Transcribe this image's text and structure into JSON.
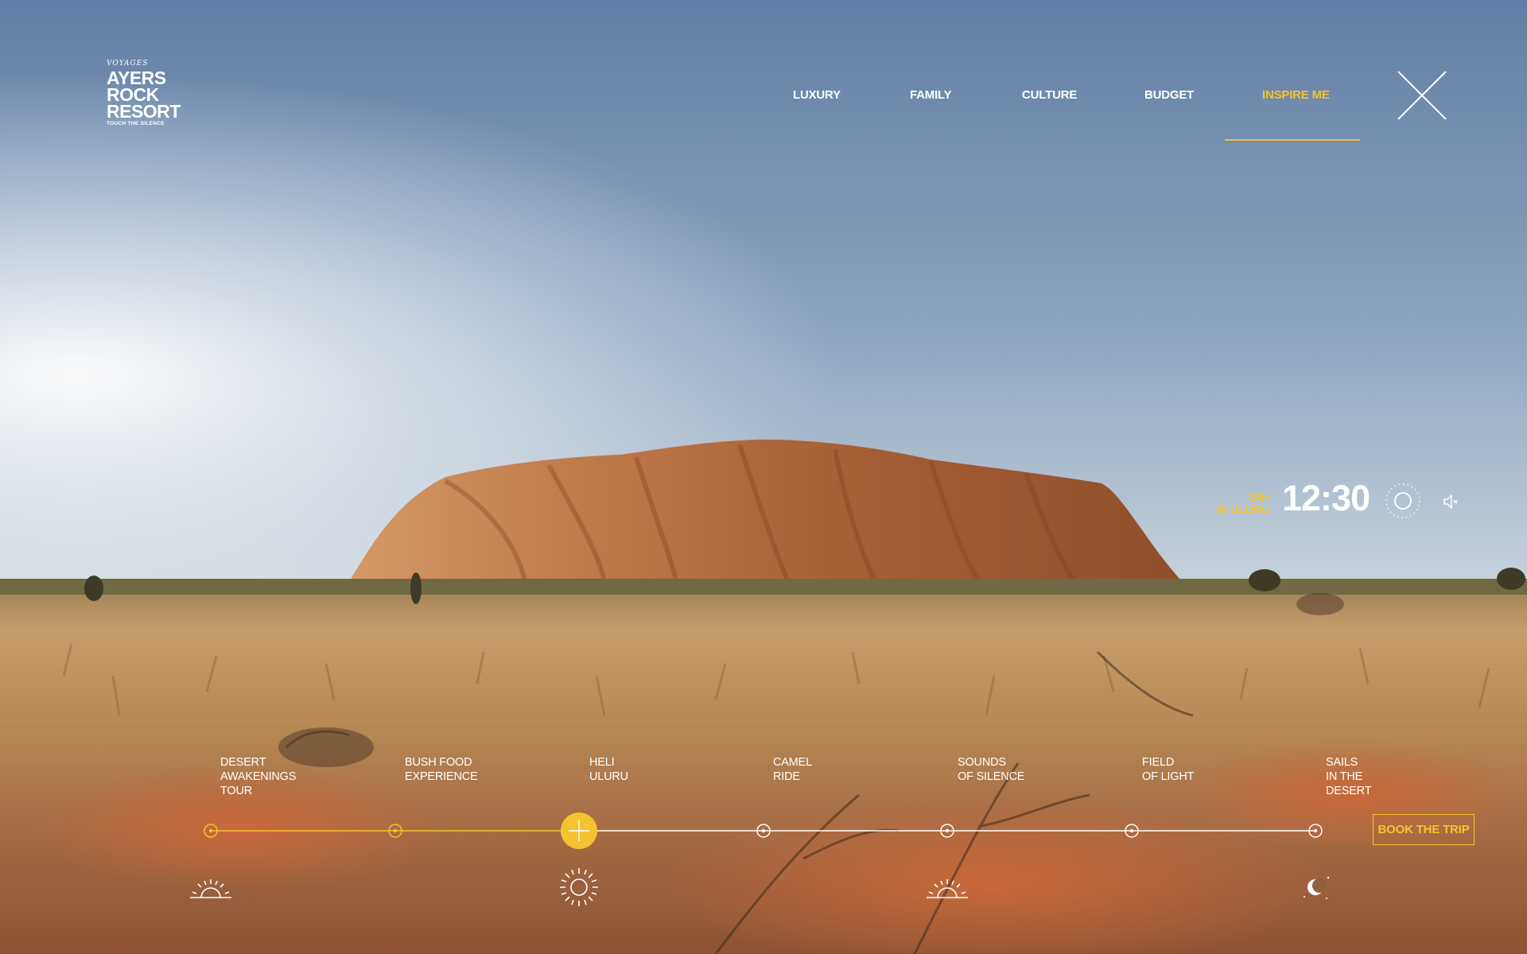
{
  "logo": {
    "brand_small": "VOYAGES",
    "line1": "AYERS",
    "line2": "ROCK",
    "line3": "RESORT",
    "tagline": "TOUCH THE SILENCE"
  },
  "nav": {
    "items": [
      {
        "label": "LUXURY"
      },
      {
        "label": "FAMILY"
      },
      {
        "label": "CULTURE"
      },
      {
        "label": "BUDGET"
      },
      {
        "label": "INSPIRE ME",
        "active": true
      }
    ],
    "close_icon": "close-icon"
  },
  "clock": {
    "label_line1": "24H",
    "label_line2": "IN ULURU",
    "time": "12:30",
    "phase_icon": "sun-icon",
    "sound_icon": "speaker-icon"
  },
  "timeline": {
    "progress_index": 2,
    "items": [
      {
        "label": "DESERT\nAWAKENINGS\nTOUR",
        "state": "passed",
        "time_icon": "sunrise-icon"
      },
      {
        "label": "BUSH FOOD\nEXPERIENCE",
        "state": "passed",
        "time_icon": null
      },
      {
        "label": "HELI\nULURU",
        "state": "current",
        "time_icon": "sun-icon"
      },
      {
        "label": "CAMEL\nRIDE",
        "state": "upcoming",
        "time_icon": null
      },
      {
        "label": "SOUNDS\nOF SILENCE",
        "state": "upcoming",
        "time_icon": "sunset-icon"
      },
      {
        "label": "FIELD\nOF LIGHT",
        "state": "upcoming",
        "time_icon": null
      },
      {
        "label": "SAILS\nIN THE\nDESERT",
        "state": "upcoming",
        "time_icon": "moon-icon"
      }
    ],
    "book_label": "BOOK THE TRIP"
  },
  "colors": {
    "accent": "#f6c330",
    "sky_top": "#627ea6",
    "sky_horizon": "#f4f1ea",
    "rock": "#b46a3c",
    "grass": "#b98a4f",
    "sand": "#c06a3a"
  }
}
